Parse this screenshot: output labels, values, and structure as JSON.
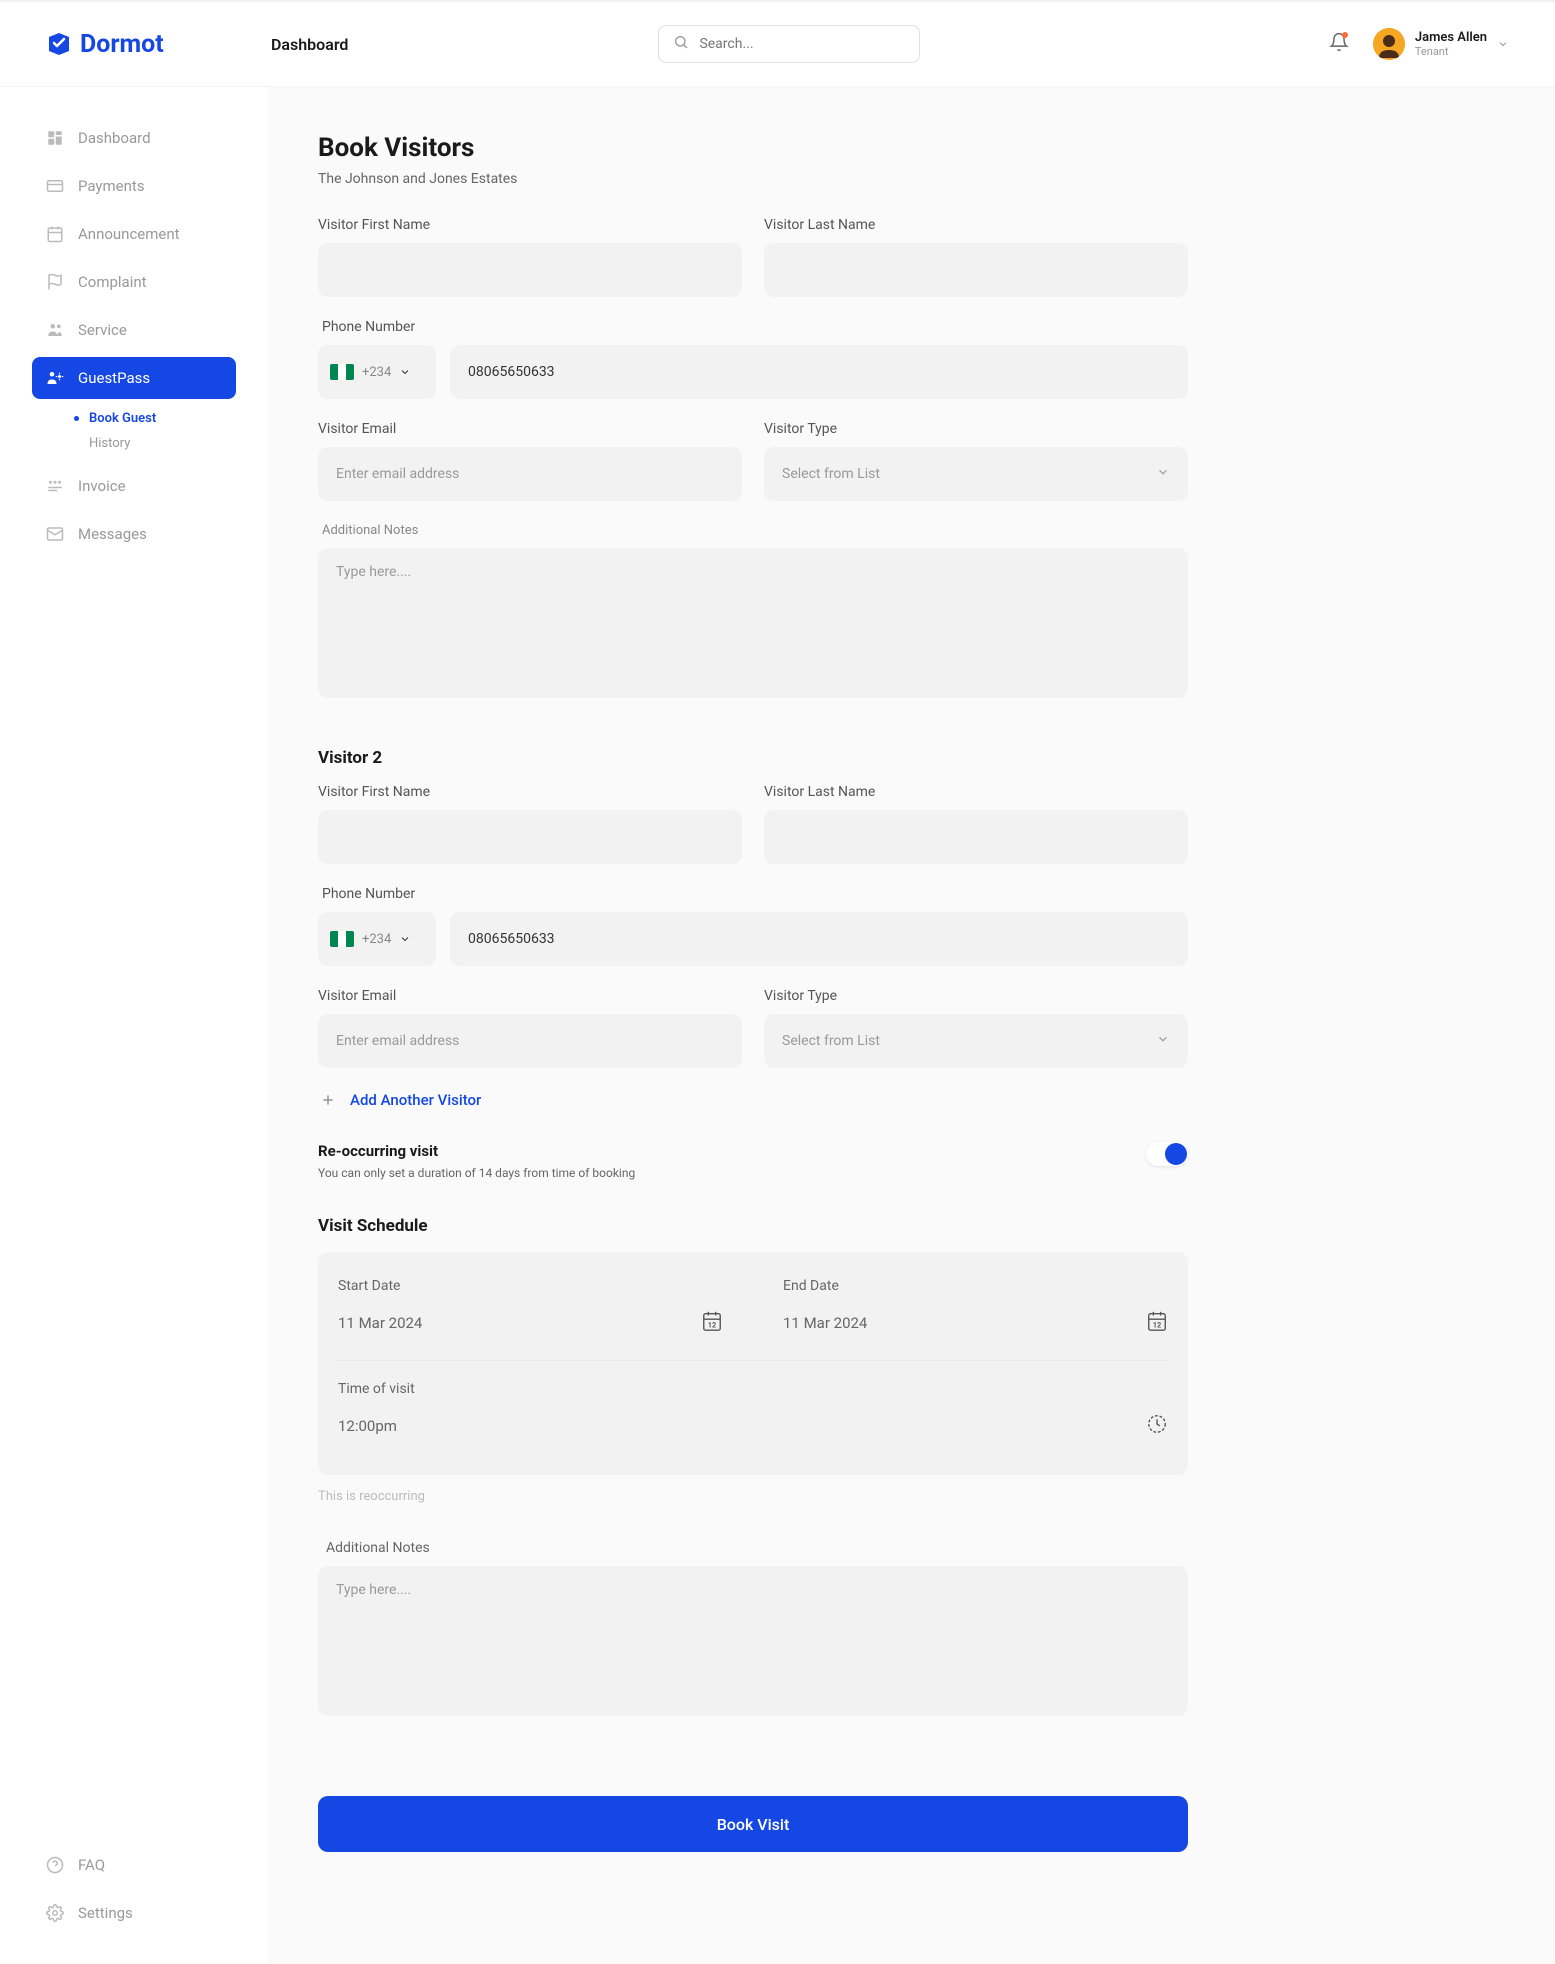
{
  "brand": {
    "name": "Dormot"
  },
  "header": {
    "page_label": "Dashboard",
    "search_placeholder": "Search...",
    "user_name": "James Allen",
    "user_role": "Tenant"
  },
  "sidebar": {
    "dashboard": "Dashboard",
    "payments": "Payments",
    "announcement": "Announcement",
    "complaint": "Complaint",
    "service": "Service",
    "guestpass": "GuestPass",
    "guestpass_book": "Book Guest",
    "guestpass_history": "History",
    "invoice": "Invoice",
    "messages": "Messages",
    "faq": "FAQ",
    "settings": "Settings"
  },
  "page": {
    "title": "Book Visitors",
    "subtitle": "The Johnson and Jones Estates"
  },
  "labels": {
    "first_name": "Visitor First Name",
    "last_name": "Visitor Last Name",
    "phone": "Phone Number",
    "email": "Visitor Email",
    "visitor_type": "Visitor Type",
    "additional_notes": "Additional Notes",
    "visitor2_heading": "Visitor 2",
    "add_another": "Add Another Visitor",
    "recurring_title": "Re-occurring visit",
    "recurring_note": "You can only set a duration of 14 days from time of booking",
    "schedule_heading": "Visit Schedule",
    "start_date": "Start Date",
    "end_date": "End Date",
    "time_of_visit": "Time of visit",
    "reoccurring_helper": "This is reoccurring",
    "book_visit": "Book Visit",
    "email_placeholder": "Enter email address",
    "select_placeholder": "Select from List",
    "textarea_placeholder": "Type here....",
    "dial_code": "+234"
  },
  "values": {
    "phone1": "08065650633",
    "phone2": "08065650633",
    "start_date": "11 Mar 2024",
    "end_date": "11 Mar 2024",
    "time": "12:00pm"
  }
}
